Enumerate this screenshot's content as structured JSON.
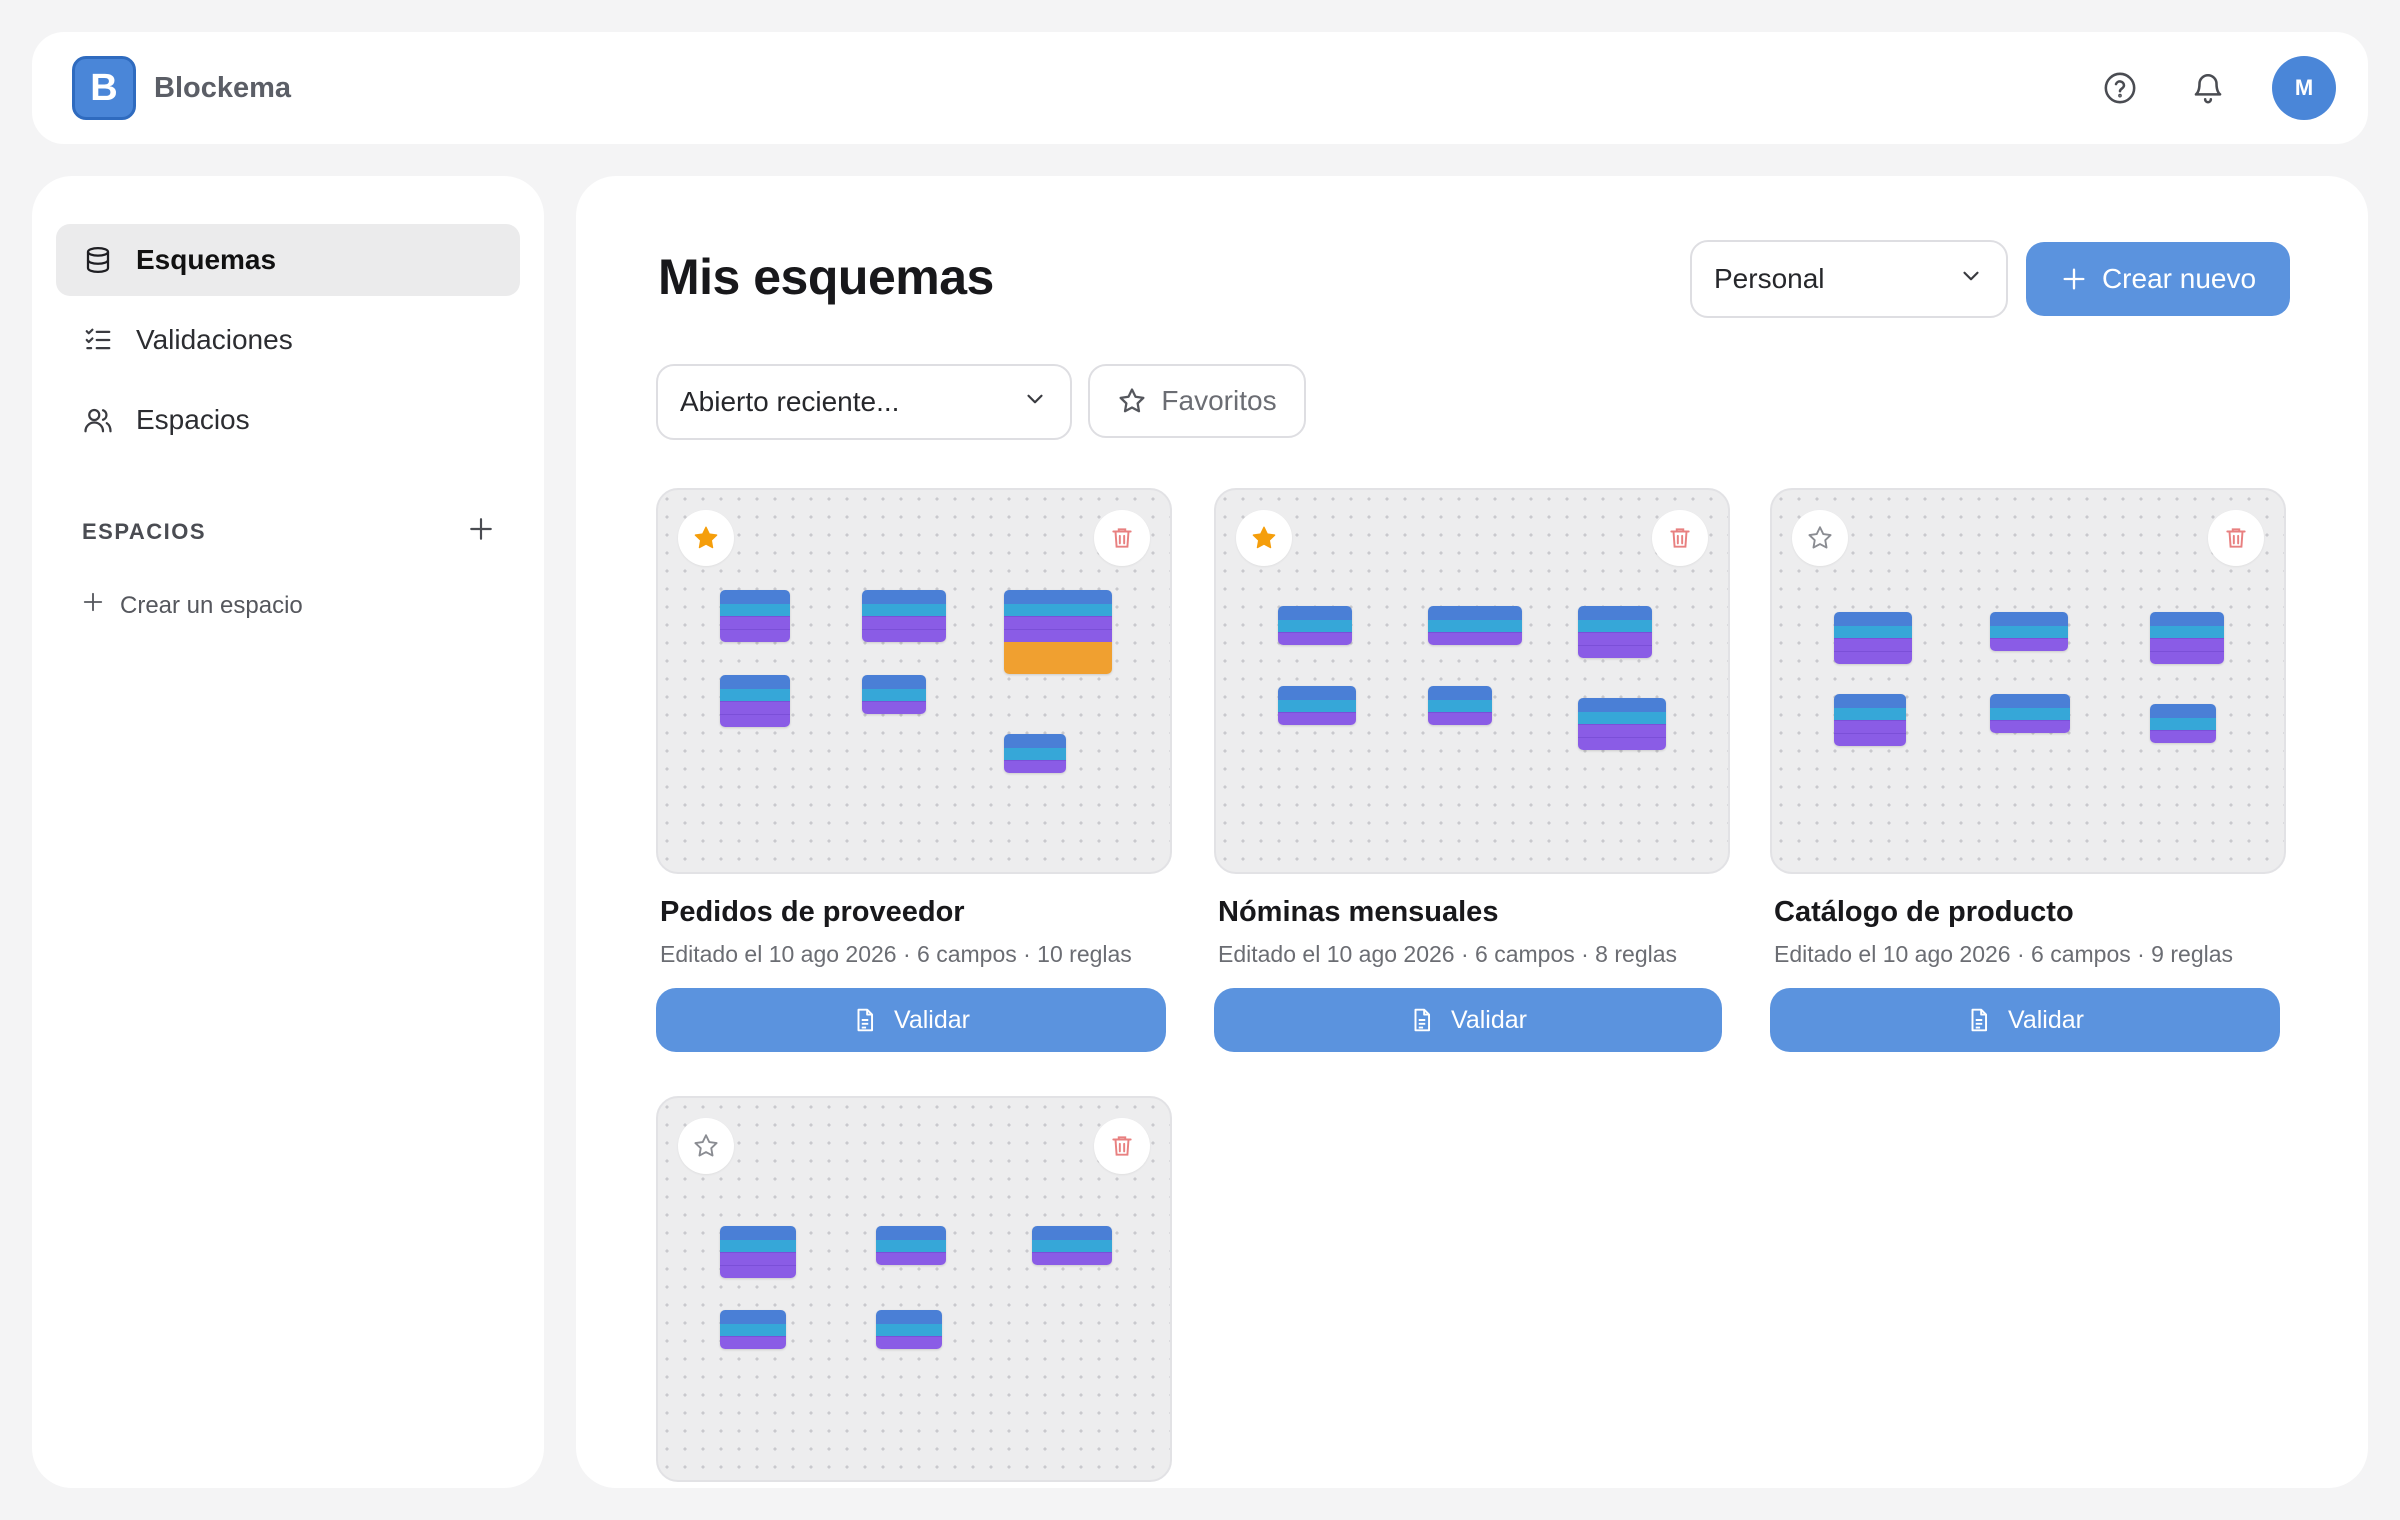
{
  "app": {
    "logo_letter": "B",
    "name": "Blockema"
  },
  "header": {
    "avatar_initial": "M"
  },
  "sidebar": {
    "items": [
      {
        "label": "Esquemas",
        "icon": "database-icon",
        "active": true
      },
      {
        "label": "Validaciones",
        "icon": "checklist-icon",
        "active": false
      },
      {
        "label": "Espacios",
        "icon": "users-icon",
        "active": false
      }
    ],
    "section_title": "ESPACIOS",
    "create_space_label": "Crear un espacio"
  },
  "main": {
    "title": "Mis esquemas",
    "workspace_select": "Personal",
    "create_label": "Crear nuevo",
    "sort_select": "Abierto reciente...",
    "favorites_label": "Favoritos"
  },
  "cards": [
    {
      "title": "Pedidos de proveedor",
      "meta": "Editado el 10 ago 2026 · 6 campos · 10 reglas",
      "favorite": true,
      "button": "Validar"
    },
    {
      "title": "Nóminas mensuales",
      "meta": "Editado el 10 ago 2026 · 6 campos · 8 reglas",
      "favorite": true,
      "button": "Validar"
    },
    {
      "title": "Catálogo de producto",
      "meta": "Editado el 10 ago 2026 · 6 campos · 9 reglas",
      "favorite": false,
      "button": "Validar"
    },
    {
      "title": "",
      "meta": "",
      "favorite": false,
      "button": ""
    }
  ],
  "colors": {
    "accent": "#5b93de",
    "favorite_star": "#f59e0b",
    "delete_icon": "#e88080",
    "block_title": "#4a7fd6",
    "block_type": "#36a7d8",
    "block_rule": "#8a5ce6"
  }
}
